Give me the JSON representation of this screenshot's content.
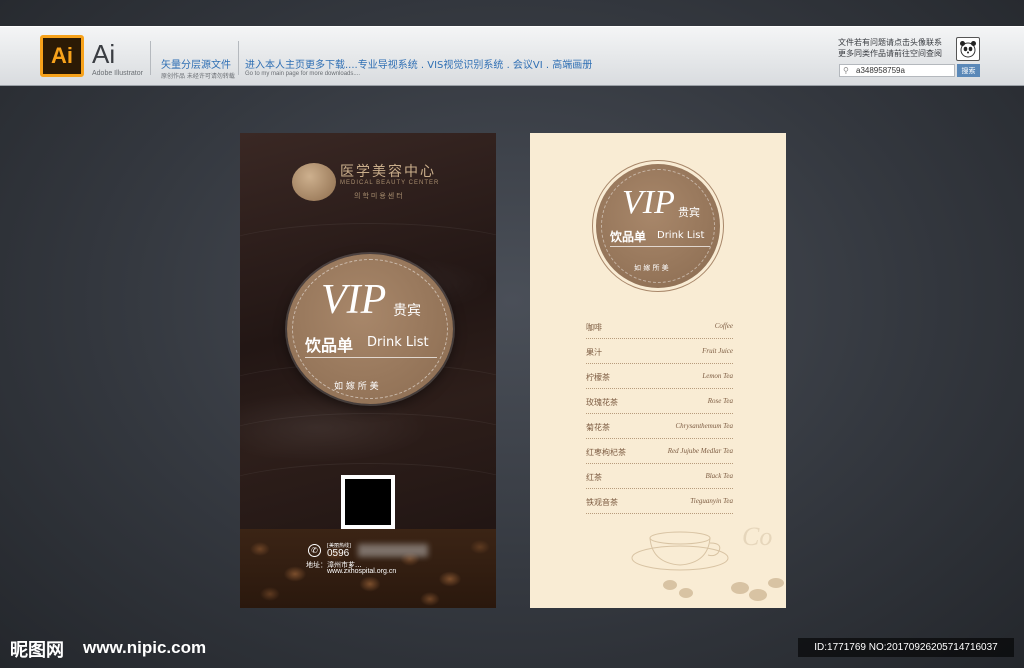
{
  "banner": {
    "app_badge": "Ai",
    "app_name": "Ai",
    "app_full": "Adobe Illustrator",
    "source_title": "矢量分层源文件",
    "source_sub": "原创作品 未经许可请勿转载",
    "promo_text": "进入本人主页更多下载....专业导视系统 . VIS视觉识别系统 . 会议VI . 高端画册",
    "promo_sub": "Go to my main page for more downloads....",
    "notice_line1": "文件若有问题请点击头像联系",
    "notice_line2": "更多同类作品请前往空间查阅",
    "search_value": "a348958759a",
    "search_button": "搜索"
  },
  "dark_card": {
    "hospital_name": "医学美容中心",
    "hospital_en": "MEDICAL BEAUTY CENTER",
    "hospital_kr": "의학미용센터",
    "vip": "VIP",
    "vip_cn": "贵宾",
    "drink_cn": "饮品单",
    "drink_en": "Drink List",
    "motto": "如 嫁 所 美",
    "hotline_label": "[美丽热线]",
    "phone": "0596",
    "address": "地址：漳州市芗...",
    "website": "www.zxhospital.org.cn"
  },
  "light_card": {
    "vip": "VIP",
    "vip_cn": "贵宾",
    "drink_cn": "饮品单",
    "drink_en": "Drink List",
    "motto": "如 嫁 所 美",
    "menu": [
      {
        "cn": "咖啡",
        "en": "Coffee"
      },
      {
        "cn": "果汁",
        "en": "Fruit Juice"
      },
      {
        "cn": "柠檬茶",
        "en": "Lemon Tea"
      },
      {
        "cn": "玫瑰花茶",
        "en": "Rose Tea"
      },
      {
        "cn": "菊花茶",
        "en": "Chrysanthemum Tea"
      },
      {
        "cn": "红枣枸杞茶",
        "en": "Red Jujube Medlar Tea"
      },
      {
        "cn": "红茶",
        "en": "Black Tea"
      },
      {
        "cn": "铁观音茶",
        "en": "Tieguanyin Tea"
      }
    ]
  },
  "footer": {
    "site_logo": "昵图网",
    "site_url": "www.nipic.com",
    "image_id": "ID:1771769 NO:20170926205714716037"
  },
  "colors": {
    "accent_brown": "#8a6b50",
    "cream": "#f9ecd4",
    "link_blue": "#2f6fb4",
    "ai_orange": "#f7a21b"
  }
}
